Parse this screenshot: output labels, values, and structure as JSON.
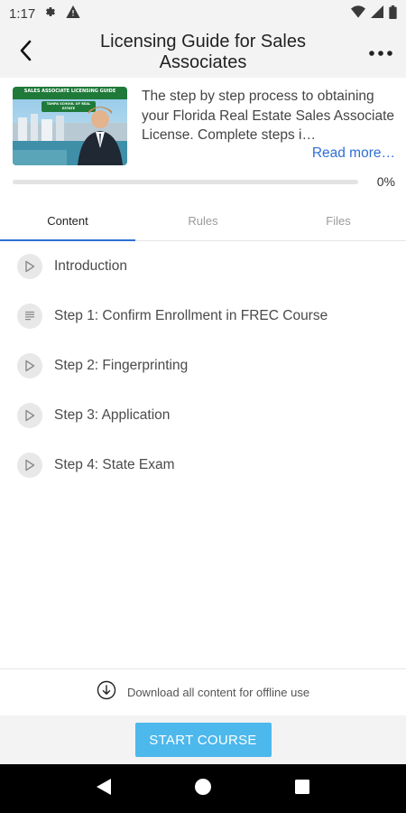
{
  "status_bar": {
    "time": "1:17",
    "icons": [
      "settings-gear-icon",
      "warning-icon",
      "wifi-icon",
      "cellular-signal-icon",
      "battery-icon"
    ]
  },
  "header": {
    "title": "Licensing Guide for Sales Associates",
    "back_icon": "chevron-left-icon",
    "more_icon": "more-horizontal-icon"
  },
  "course": {
    "thumbnail_banner": "SALES ASSOCIATE LICENSING GUIDE",
    "thumbnail_logo": "TAMPA SCHOOL OF REAL ESTATE",
    "description": "The step by step process to obtaining your Florida Real Estate Sales Associate License. Complete steps i…",
    "read_more": "Read more…",
    "progress_text": "0%",
    "progress_value": 0
  },
  "tabs": [
    {
      "label": "Content",
      "active": true
    },
    {
      "label": "Rules",
      "active": false
    },
    {
      "label": "Files",
      "active": false
    }
  ],
  "lessons": [
    {
      "label": "Introduction",
      "icon": "play-icon"
    },
    {
      "label": "Step 1: Confirm Enrollment in FREC Course",
      "icon": "text-lines-icon"
    },
    {
      "label": "Step 2: Fingerprinting",
      "icon": "play-icon"
    },
    {
      "label": "Step 3: Application",
      "icon": "play-icon"
    },
    {
      "label": "Step 4: State Exam",
      "icon": "play-icon"
    }
  ],
  "download": {
    "label": "Download all content for offline use",
    "icon": "download-circle-icon"
  },
  "start_button": "START COURSE",
  "colors": {
    "accent": "#2f6fd6",
    "button": "#4db8ec",
    "header_bg": "#f3f3f3"
  }
}
